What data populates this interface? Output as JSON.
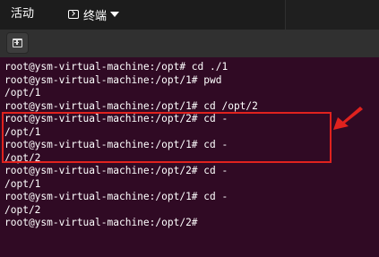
{
  "topbar": {
    "activities_label": "活动",
    "app_menu_label": "终端",
    "app_icon": "terminal-icon",
    "chevron_icon": "triangle-down-icon"
  },
  "headerbar": {
    "new_tab_icon": "new-tab-icon"
  },
  "terminal": {
    "background_color": "#300a24",
    "lines": [
      "root@ysm-virtual-machine:/opt# cd ./1",
      "root@ysm-virtual-machine:/opt/1# pwd",
      "/opt/1",
      "root@ysm-virtual-machine:/opt/1# cd /opt/2",
      "root@ysm-virtual-machine:/opt/2# cd -",
      "/opt/1",
      "root@ysm-virtual-machine:/opt/1# cd -",
      "/opt/2",
      "root@ysm-virtual-machine:/opt/2# cd -",
      "/opt/1",
      "root@ysm-virtual-machine:/opt/1# cd -",
      "/opt/2",
      "root@ysm-virtual-machine:/opt/2#"
    ]
  },
  "annotation": {
    "color": "#e0221e"
  }
}
